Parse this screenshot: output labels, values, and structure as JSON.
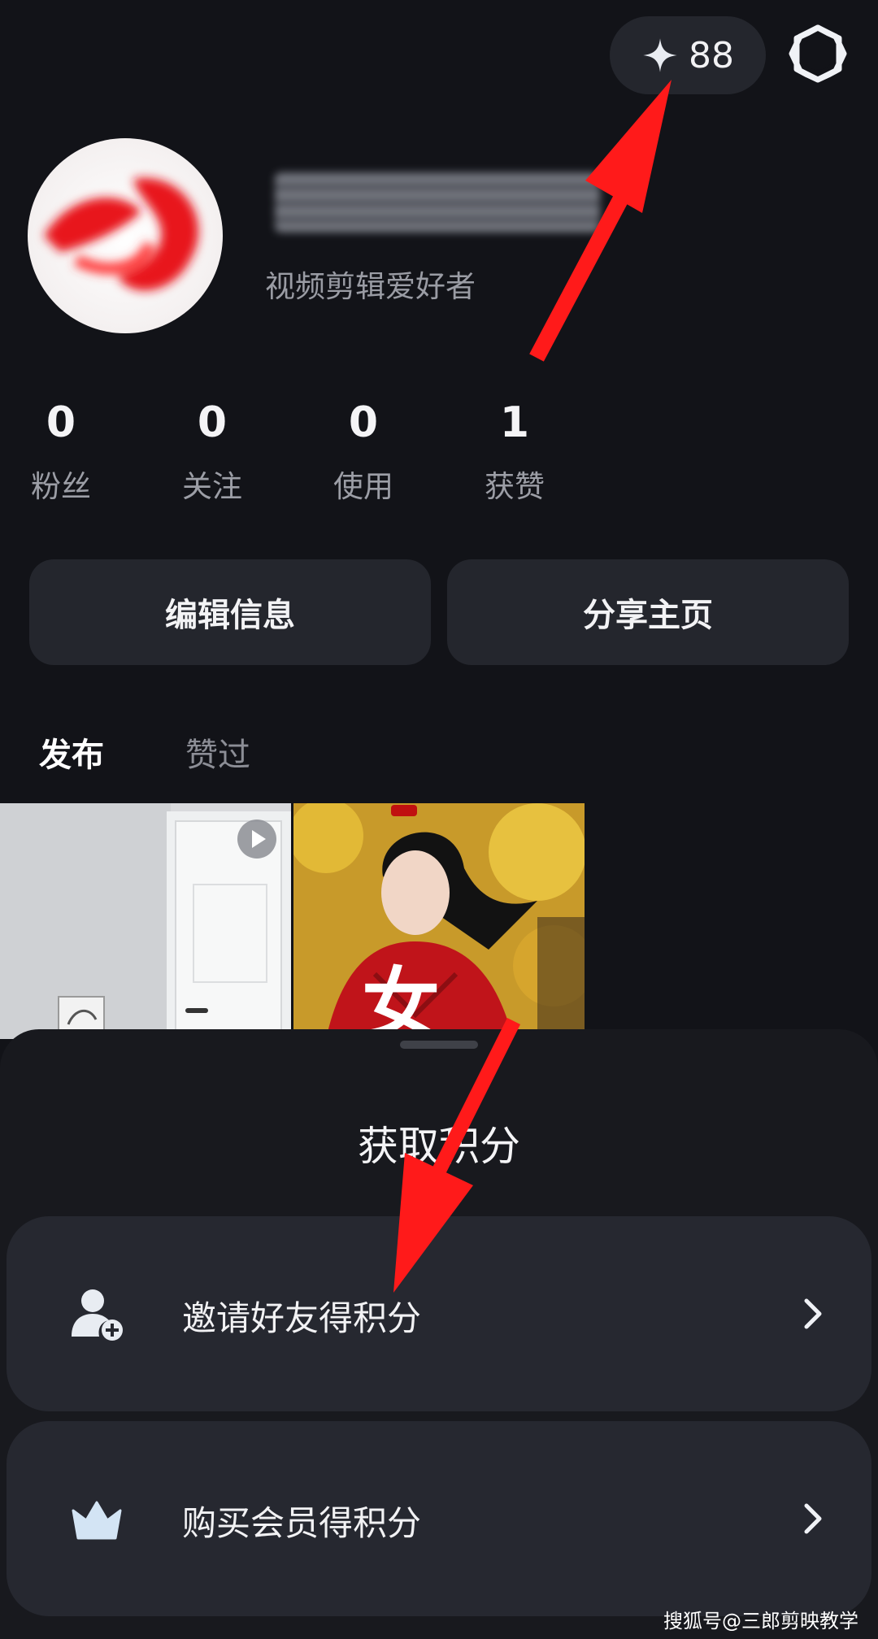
{
  "header": {
    "points_icon": "sparkle-icon",
    "points_value": "88",
    "settings_icon": "gear-icon"
  },
  "profile": {
    "bio": "视频剪辑爱好者"
  },
  "stats": [
    {
      "value": "0",
      "label": "粉丝"
    },
    {
      "value": "0",
      "label": "关注"
    },
    {
      "value": "0",
      "label": "使用"
    },
    {
      "value": "1",
      "label": "获赞"
    }
  ],
  "actions": {
    "edit_label": "编辑信息",
    "share_label": "分享主页"
  },
  "tabs": [
    {
      "label": "发布",
      "active": true
    },
    {
      "label": "赞过",
      "active": false
    }
  ],
  "thumbnails": [
    {
      "name": "room-door-thumbnail",
      "has_play_icon": true
    },
    {
      "name": "red-dress-woman-thumbnail",
      "overlay_text": "女"
    }
  ],
  "sheet": {
    "title": "获取积分",
    "options": [
      {
        "label": "邀请好友得积分",
        "icon": "add-user-icon"
      },
      {
        "label": "购买会员得积分",
        "icon": "crown-icon"
      }
    ]
  },
  "watermark": "搜狐号@三郎剪映教学",
  "colors": {
    "background": "#121318",
    "card": "#24262d",
    "sheet": "#18191e",
    "option": "#262830",
    "annotation_arrow": "#ff1a1a"
  }
}
